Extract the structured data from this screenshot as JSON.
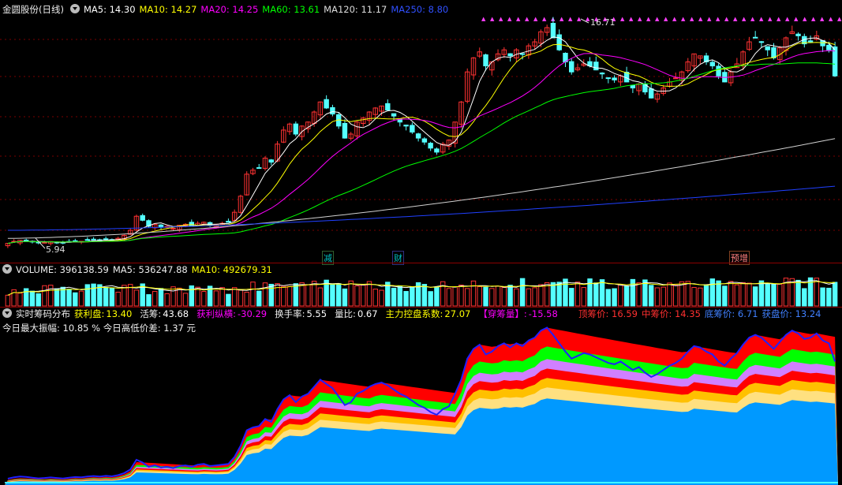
{
  "main_panel": {
    "title": "金圆股份(日线)",
    "ma_labels": [
      {
        "text": "MA5: 14.30",
        "color": "#ffffff"
      },
      {
        "text": "MA10: 14.27",
        "color": "#ffff00"
      },
      {
        "text": "MA20: 14.25",
        "color": "#ff00ff"
      },
      {
        "text": "MA60: 13.61",
        "color": "#00ff00"
      },
      {
        "text": "MA120: 11.17",
        "color": "#dddddd"
      },
      {
        "text": "MA250: 8.80",
        "color": "#3050ff"
      }
    ],
    "high_label": "16.71",
    "low_label": "5.94",
    "markers": [
      "减",
      "财",
      "预增"
    ]
  },
  "volume_panel": {
    "title": "VOLUME: 396138.59",
    "ma5": "MA5: 536247.88",
    "ma10": "MA10: 492679.31"
  },
  "chip_panel": {
    "title": "实时筹码分布",
    "items": [
      {
        "label": "获利盘:",
        "value": "13.40",
        "color": "#ffff00"
      },
      {
        "label": "活筹:",
        "value": "43.68",
        "color": "#ffffff"
      },
      {
        "label": "获利纵横:",
        "value": "-30.29",
        "color": "#ff00ff"
      },
      {
        "label": "换手率:",
        "value": "5.55",
        "color": "#ffffff"
      },
      {
        "label": "量比:",
        "value": "0.67",
        "color": "#ffffff"
      },
      {
        "label": "主力控盘系数:",
        "value": "27.07",
        "color": "#ffff00"
      },
      {
        "label": "【穿筹量】:",
        "value": "-15.58",
        "color": "#ff00ff"
      }
    ],
    "prices": [
      {
        "label": "顶筹价:",
        "value": "16.59",
        "color": "#ff3030"
      },
      {
        "label": "中筹价:",
        "value": "14.35",
        "color": "#ff3030"
      },
      {
        "label": "底筹价:",
        "value": "6.71",
        "color": "#4080ff"
      },
      {
        "label": "获盘价:",
        "value": "13.24",
        "color": "#4080ff"
      }
    ],
    "line2": "今日最大振幅: 10.85 %   今日高低价差: 1.37 元"
  },
  "chart_data": {
    "type": "candlestick",
    "close_values": [
      5.95,
      6.05,
      6.1,
      6.08,
      6.02,
      5.97,
      6.0,
      6.04,
      6.0,
      5.96,
      6.02,
      6.07,
      6.05,
      6.1,
      6.14,
      6.1,
      6.15,
      6.12,
      6.2,
      6.35,
      6.6,
      7.3,
      7.1,
      6.8,
      6.9,
      6.75,
      6.8,
      6.7,
      6.85,
      6.9,
      6.8,
      6.95,
      7.0,
      6.85,
      6.9,
      6.95,
      7.0,
      7.5,
      8.3,
      9.4,
      9.6,
      9.7,
      10.2,
      10.0,
      10.9,
      11.6,
      11.9,
      11.4,
      11.8,
      12.0,
      12.5,
      13.0,
      12.7,
      12.4,
      11.8,
      11.2,
      11.4,
      12.0,
      12.2,
      12.5,
      12.7,
      12.8,
      12.6,
      12.3,
      12.0,
      11.8,
      11.5,
      11.2,
      11.0,
      10.7,
      10.5,
      10.9,
      11.1,
      12.0,
      13.0,
      14.5,
      15.2,
      15.5,
      14.8,
      15.0,
      15.4,
      15.6,
      15.3,
      15.6,
      15.4,
      15.8,
      16.0,
      16.5,
      16.71,
      16.2,
      15.6,
      15.0,
      14.5,
      14.7,
      14.9,
      14.8,
      14.6,
      14.4,
      14.2,
      14.1,
      14.3,
      14.0,
      13.7,
      13.9,
      13.5,
      13.2,
      13.4,
      13.7,
      14.0,
      14.2,
      14.5,
      15.0,
      15.4,
      15.3,
      15.0,
      14.8,
      14.3,
      14.0,
      14.5,
      14.9,
      15.5,
      16.0,
      16.2,
      16.0,
      15.6,
      15.2,
      15.7,
      16.2,
      16.5,
      16.3,
      15.9,
      16.0,
      16.3,
      15.8,
      15.6,
      14.3
    ],
    "price_range": [
      5.5,
      17.3
    ],
    "annotations": [
      "16.71",
      "5.94",
      "减",
      "财",
      "预增"
    ]
  }
}
